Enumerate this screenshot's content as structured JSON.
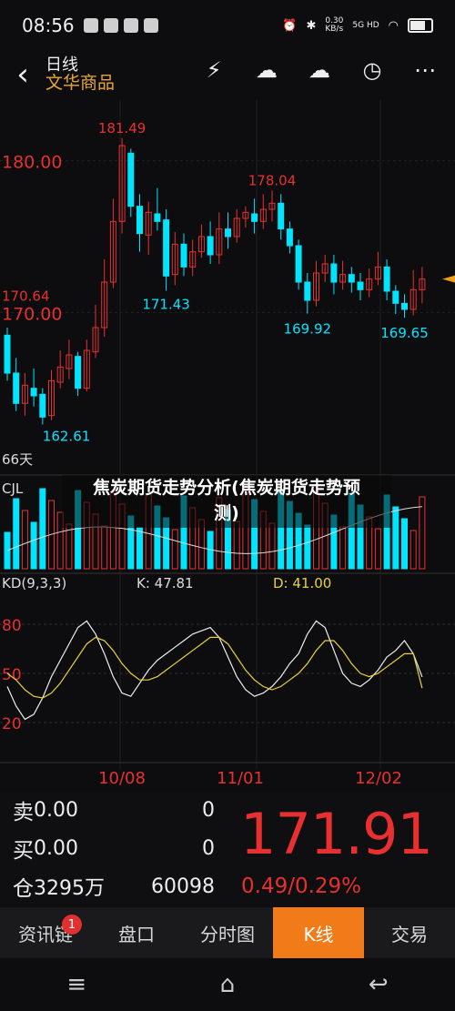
{
  "status": {
    "time": "08:56",
    "speed": "0.30\nKB/s",
    "network": "5G HD"
  },
  "header": {
    "period": "日线",
    "name": "文华商品"
  },
  "chart_data": {
    "type": "candlestick",
    "price_labels": {
      "high_axis": "180.00",
      "mid_axis": "170.00",
      "left_upper": "170.64",
      "days": "66天"
    },
    "annotations": [
      {
        "label": "181.49"
      },
      {
        "label": "171.43"
      },
      {
        "label": "178.04"
      },
      {
        "label": "169.92"
      },
      {
        "label": "169.65"
      },
      {
        "label": "162.61"
      }
    ],
    "ylim": [
      160,
      184
    ],
    "candles": [
      [
        168.5,
        166,
        169,
        165.5
      ],
      [
        166,
        164,
        167,
        163.5
      ],
      [
        164,
        165.2,
        166,
        163.2
      ],
      [
        165,
        164.5,
        166.3,
        163.8
      ],
      [
        164.6,
        163.1,
        165,
        162.61
      ],
      [
        163.2,
        165.5,
        166.2,
        162.9
      ],
      [
        165.4,
        166.4,
        167.5,
        165
      ],
      [
        166.3,
        167.2,
        168.2,
        165.6
      ],
      [
        167.1,
        165,
        167.4,
        164.5
      ],
      [
        165,
        167.5,
        168.2,
        164.8
      ],
      [
        167.4,
        169,
        170.5,
        167
      ],
      [
        169,
        172,
        173.5,
        168.4
      ],
      [
        172,
        176,
        177.5,
        171.6
      ],
      [
        176,
        181,
        181.49,
        175.2
      ],
      [
        180.5,
        177,
        180.8,
        176.3
      ],
      [
        177,
        175.2,
        177.8,
        174
      ],
      [
        175.1,
        176.6,
        177.3,
        173.8
      ],
      [
        176.5,
        176,
        178.2,
        175.4
      ],
      [
        176.1,
        172.4,
        176.8,
        171.43
      ],
      [
        172.5,
        174.5,
        175.3,
        171.8
      ],
      [
        174.5,
        173,
        175.2,
        172.4
      ],
      [
        173,
        174,
        174.8,
        172.4
      ],
      [
        174,
        175,
        175.8,
        173.6
      ],
      [
        175,
        173.8,
        176,
        173.2
      ],
      [
        173.8,
        175.5,
        176.6,
        173.2
      ],
      [
        175.5,
        175,
        176.6,
        174.2
      ],
      [
        175,
        176.2,
        176.8,
        174.6
      ],
      [
        176.2,
        176.6,
        177,
        175.6
      ],
      [
        176.5,
        176,
        177.5,
        175.2
      ],
      [
        176,
        176.8,
        177.8,
        175.5
      ],
      [
        176.8,
        177.2,
        178.04,
        176
      ],
      [
        177.2,
        175.5,
        177.8,
        174.8
      ],
      [
        175.5,
        174.4,
        176,
        173.9
      ],
      [
        174.4,
        172,
        174.8,
        171.5
      ],
      [
        172,
        170.8,
        172.6,
        169.92
      ],
      [
        170.8,
        172.6,
        173.4,
        170.4
      ],
      [
        172.6,
        173.2,
        173.8,
        172
      ],
      [
        173.2,
        172,
        173.8,
        171.2
      ],
      [
        172,
        172.5,
        173.4,
        171.5
      ],
      [
        172.5,
        172,
        173,
        171.3
      ],
      [
        172,
        171.5,
        172.6,
        170.8
      ],
      [
        171.5,
        172.2,
        172.9,
        171
      ],
      [
        172.2,
        173,
        174,
        171.8
      ],
      [
        173,
        171.4,
        173.5,
        170.8
      ],
      [
        171.4,
        170.6,
        171.8,
        169.9
      ],
      [
        170.6,
        170.2,
        171.2,
        169.65
      ],
      [
        170.2,
        171.5,
        172.8,
        169.8
      ],
      [
        171.5,
        172.2,
        173,
        170.6
      ]
    ],
    "cjl": {
      "label": "CJL"
    },
    "kd": {
      "label": "KD(9,3,3)",
      "k_label": "K: 47.81",
      "d_label": "D: 41.00",
      "levels": [
        "80",
        "50",
        "20"
      ],
      "k": [
        42,
        30,
        22,
        25,
        35,
        48,
        58,
        68,
        78,
        82,
        74,
        62,
        48,
        38,
        36,
        44,
        52,
        58,
        62,
        66,
        70,
        74,
        76,
        78,
        72,
        60,
        48,
        40,
        36,
        38,
        42,
        48,
        56,
        62,
        74,
        82,
        78,
        64,
        50,
        44,
        42,
        46,
        52,
        60,
        64,
        70,
        62,
        47.81
      ],
      "d": [
        50,
        46,
        40,
        36,
        35,
        38,
        44,
        52,
        60,
        68,
        72,
        70,
        64,
        56,
        50,
        46,
        46,
        48,
        52,
        56,
        60,
        64,
        68,
        72,
        72,
        68,
        60,
        52,
        46,
        42,
        40,
        42,
        46,
        50,
        56,
        64,
        70,
        70,
        64,
        56,
        50,
        48,
        50,
        54,
        58,
        62,
        62,
        41.0
      ]
    },
    "x_ticks": [
      "10/08",
      "11/01",
      "12/02"
    ]
  },
  "overlay": {
    "line1": "焦炭期货走势分析(焦炭期货走势预",
    "line2": "测)"
  },
  "quote": {
    "sell_label": "卖",
    "sell_price": "0.00",
    "sell_vol": "0",
    "buy_label": "买",
    "buy_price": "0.00",
    "buy_vol": "0",
    "pos_label": "仓",
    "pos_value": "3295万",
    "pos_extra": "60098",
    "last": "171.91",
    "change": "0.49/0.29%"
  },
  "tabs": [
    {
      "label": "资讯链",
      "badge": "1"
    },
    {
      "label": "盘口"
    },
    {
      "label": "分时图"
    },
    {
      "label": "K线",
      "active": true
    },
    {
      "label": "交易"
    }
  ],
  "colors": {
    "up": "#e93030",
    "down": "#00e5ff",
    "accent": "#f07b18"
  }
}
